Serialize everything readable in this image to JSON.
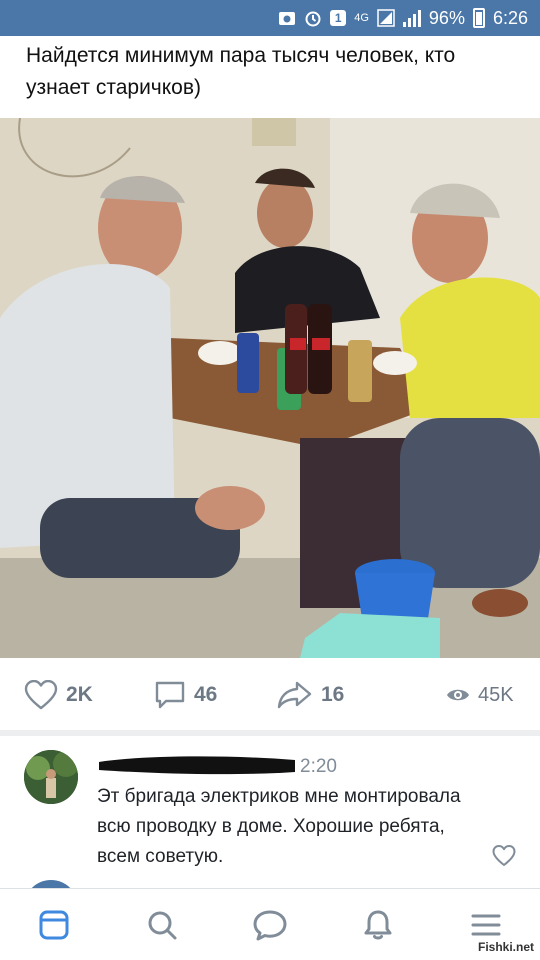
{
  "status_bar": {
    "icons": [
      "screenshot-icon",
      "alarm-icon",
      "sim-icon",
      "network-4g-icon",
      "signal-icon",
      "battery-icon"
    ],
    "sim_label": "1",
    "network_label": "4G",
    "battery_percent": "96%",
    "battery_level": 0.96,
    "time": "6:26"
  },
  "post": {
    "text": "Найдется минимум пара тысяч человек, кто узнает старичков)",
    "photo": "photo of three men sitting at a small table with drinks"
  },
  "actions": {
    "likes": "2K",
    "comments": "46",
    "reposts": "16",
    "views": "45K"
  },
  "comment": {
    "time": "2:20",
    "text": "Эт бригада электриков мне монтировала всю проводку в доме. Хорошие ребята, всем советую."
  },
  "bottom_nav": {
    "items": [
      "news-icon",
      "search-icon",
      "messages-icon",
      "notifications-icon",
      "menu-icon"
    ]
  },
  "watermark": "Fishki.net",
  "colors": {
    "status_bar": "#4a76a8",
    "icon_gray": "#818c99",
    "nav_blue": "#3f8ae0"
  }
}
